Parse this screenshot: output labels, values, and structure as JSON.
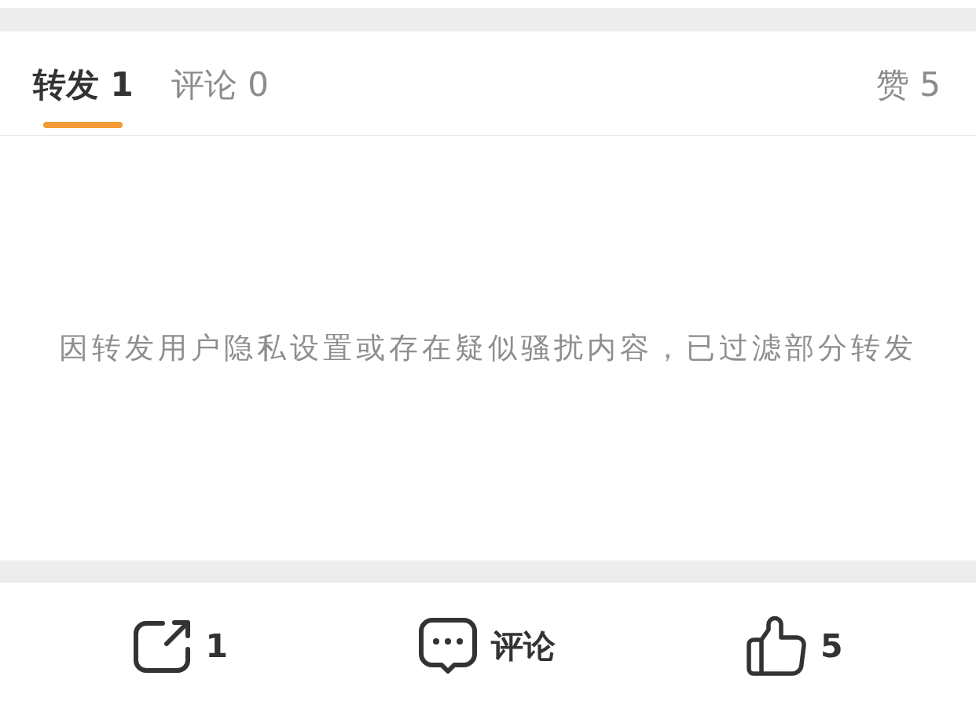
{
  "tabs": [
    {
      "label": "转发 1",
      "selected": true
    },
    {
      "label": "评论 0",
      "selected": false
    }
  ],
  "likes_tab": {
    "label": "赞 5",
    "selected": false
  },
  "notice": "因转发用户隐私设置或存在疑似骚扰内容，已过滤部分转发",
  "actions": [
    {
      "kind": "repost",
      "label": "1"
    },
    {
      "kind": "comment",
      "label": "评论"
    },
    {
      "kind": "like",
      "label": "5"
    }
  ]
}
